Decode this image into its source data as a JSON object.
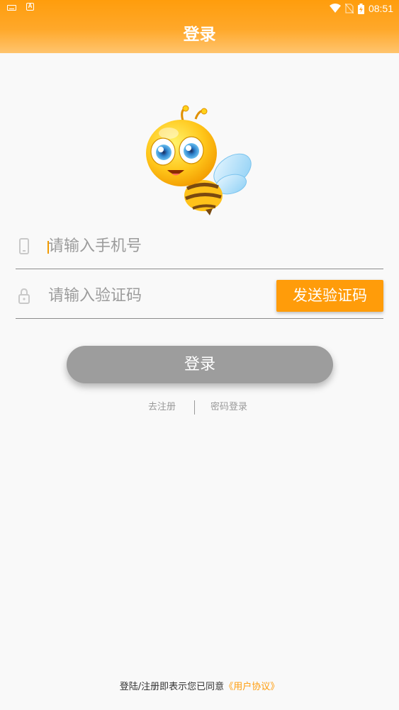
{
  "status_bar": {
    "time": "08:51",
    "left_icons": [
      "keyboard-icon",
      "android-notification-icon"
    ],
    "right_icons": [
      "wifi-icon",
      "no-sim-icon",
      "battery-charging-icon"
    ]
  },
  "header": {
    "title": "登录",
    "gradient_top": "#ff9d0c",
    "gradient_bottom": "#ffc46e"
  },
  "logo": {
    "icon": "bee-mascot-icon"
  },
  "form": {
    "phone": {
      "placeholder": "请输入手机号",
      "value": "",
      "icon": "phone-icon"
    },
    "code": {
      "placeholder": "请输入验证码",
      "value": "",
      "icon": "lock-icon"
    },
    "send_code_label": "发送验证码"
  },
  "login_button_label": "登录",
  "links": {
    "register": "去注册",
    "password_login": "密码登录"
  },
  "footer": {
    "agreement_text": "登陆/注册即表示您已同意",
    "agreement_link": "《用户协议》"
  },
  "colors": {
    "accent": "#ff9c0a",
    "button_disabled": "#9d9d9d",
    "background": "#f9f9f9"
  }
}
